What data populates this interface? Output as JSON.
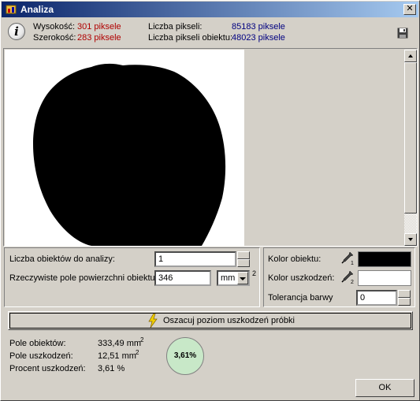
{
  "window": {
    "title": "Analiza"
  },
  "info": {
    "height_label": "Wysokość:",
    "height_value": "301 piksele",
    "width_label": "Szerokość:",
    "width_value": "283 piksele",
    "pixels_label": "Liczba pikseli:",
    "pixels_value": "85183 piksele",
    "object_pixels_label": "Liczba pikseli obiektu:",
    "object_pixels_value": "48023 piksele"
  },
  "settings": {
    "objects_count_label": "Liczba obiektów do analizy:",
    "objects_count_value": "1",
    "real_area_label": "Rzeczywiste pole powierzchni obiektu:",
    "real_area_value": "346",
    "unit_value": "mm",
    "unit_exponent": "2"
  },
  "colors": {
    "object_color_label": "Kolor obiektu:",
    "object_color_value": "#000000",
    "damage_color_label": "Kolor uszkodzeń:",
    "damage_color_value": "#ffffff",
    "tolerance_label": "Tolerancja barwy",
    "tolerance_value": "0",
    "dropper1_index": "1",
    "dropper2_index": "2"
  },
  "actions": {
    "estimate_label": "Oszacuj poziom uszkodzeń próbki",
    "ok_label": "OK"
  },
  "results": {
    "object_area_label": "Pole obiektów:",
    "object_area_value": "333,49 mm",
    "damage_area_label": "Pole uszkodzeń:",
    "damage_area_value": "12,51 mm",
    "exponent": "2",
    "damage_percent_label": "Procent uszkodzeń:",
    "damage_percent_value": "3,61 %",
    "circle_label": "3,61%"
  },
  "icons": {
    "info": "info-icon",
    "save": "save-icon",
    "close": "close-icon",
    "dropper": "eyedropper-icon",
    "bolt": "lightning-icon"
  }
}
